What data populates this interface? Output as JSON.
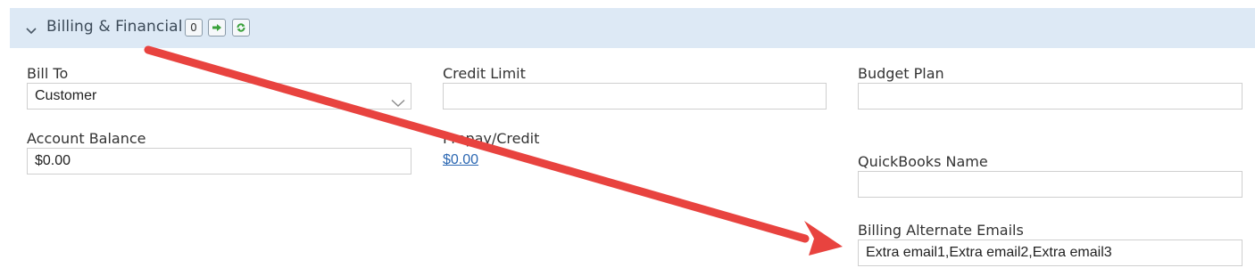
{
  "section": {
    "title": "Billing & Financial",
    "count": "0",
    "icons": [
      "chevron-down-icon",
      "forward-arrow-icon",
      "refresh-icon"
    ]
  },
  "fields": {
    "bill_to": {
      "label": "Bill To",
      "value": "Customer"
    },
    "credit_limit": {
      "label": "Credit Limit",
      "value": ""
    },
    "budget_plan": {
      "label": "Budget Plan",
      "value": ""
    },
    "account_balance": {
      "label": "Account Balance",
      "value": "$0.00"
    },
    "prepay_credit": {
      "label": "Prepay/Credit",
      "value": "$0.00"
    },
    "quickbooks_name": {
      "label": "QuickBooks Name",
      "value": ""
    },
    "billing_alt_emails": {
      "label": "Billing Alternate Emails",
      "value": "Extra email1,Extra email2,Extra email3"
    }
  },
  "colors": {
    "header_bg": "#dde9f5",
    "annotation_arrow": "#e8433f",
    "link": "#2b67b2"
  }
}
